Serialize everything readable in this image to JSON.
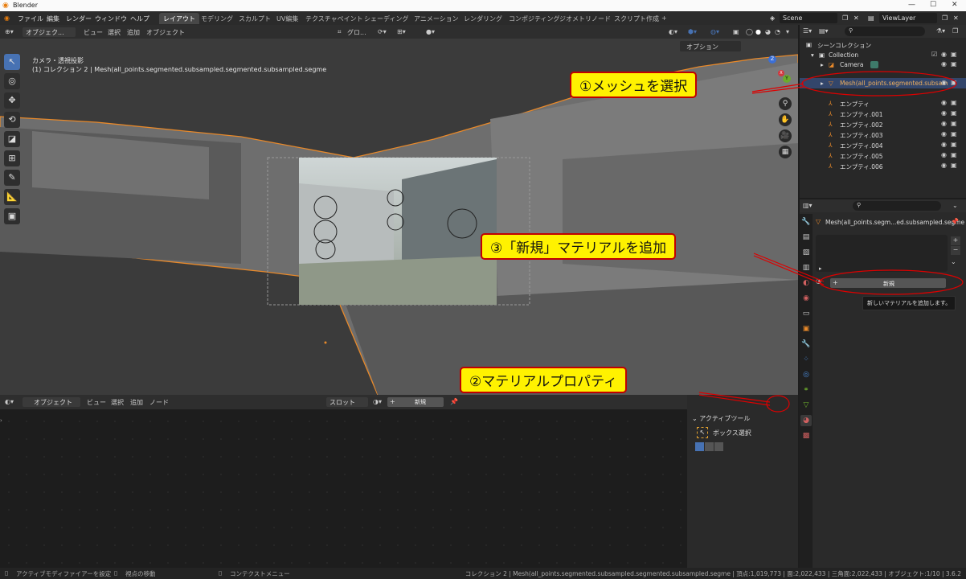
{
  "window": {
    "title": "Blender",
    "min": "—",
    "max": "☐",
    "close": "✕"
  },
  "menubar": {
    "menus": [
      "ファイル",
      "編集",
      "レンダー",
      "ウィンドウ",
      "ヘルプ"
    ],
    "workspaces": [
      "レイアウト",
      "モデリング",
      "スカルプト",
      "UV編集",
      "テクスチャペイント",
      "シェーディング",
      "アニメーション",
      "レンダリング",
      "コンポジティング",
      "ジオメトリノード",
      "スクリプト作成",
      "+"
    ],
    "scene": "Scene",
    "viewlayer": "ViewLayer"
  },
  "viewport": {
    "header": {
      "mode": "オブジェク...",
      "menus": [
        "ビュー",
        "選択",
        "追加",
        "オブジェクト"
      ],
      "orientation": "グロ...",
      "options": "オプション"
    },
    "info_line1": "カメラ・透視投影",
    "info_line2": "(1) コレクション 2 | Mesh(all_points.segmented.subsampled.segmented.subsampled.segme",
    "gizmo": {
      "z": "Z",
      "y": "Y",
      "x": "X"
    }
  },
  "callouts": {
    "c1": "①メッシュを選択",
    "c2": "②マテリアルプロパティ",
    "c3": "③「新規」マテリアルを追加"
  },
  "outliner": {
    "title": "シーンコレクション",
    "rows": [
      {
        "label": "Collection"
      },
      {
        "label": "Camera"
      },
      {
        "label": "Mesh(all_points.segmented.subsam"
      },
      {
        "label": "エンプティ"
      },
      {
        "label": "エンプティ.001"
      },
      {
        "label": "エンプティ.002"
      },
      {
        "label": "エンプティ.003"
      },
      {
        "label": "エンプティ.004"
      },
      {
        "label": "エンプティ.005"
      },
      {
        "label": "エンプティ.006"
      }
    ]
  },
  "properties": {
    "object_name": "Mesh(all_points.segm...ed.subsampled.segme",
    "new_button": "新規",
    "tooltip": "新しいマテリアルを追加します。"
  },
  "shader_editor": {
    "mode": "オブジェクト",
    "menus": [
      "ビュー",
      "選択",
      "追加",
      "ノード"
    ],
    "slot": "スロット",
    "new_button": "新規"
  },
  "npanel": {
    "section": "アクティブツール",
    "tool": "ボックス選択"
  },
  "statusbar": {
    "left1": "アクティブモディファイアーを設定",
    "left2": "視点の移動",
    "left3": "コンテクストメニュー",
    "right": "コレクション 2 | Mesh(all_points.segmented.subsampled.segmented.subsampled.segme | 頂点:1,019,773 | 面:2,022,433 | 三角面:2,022,433 | オブジェクト:1/10 | 3.6.2"
  },
  "colors": {
    "accent": "#4772b3",
    "callout_fill": "#fff200",
    "callout_border": "#c00000",
    "selection_outline": "#e8892a"
  }
}
